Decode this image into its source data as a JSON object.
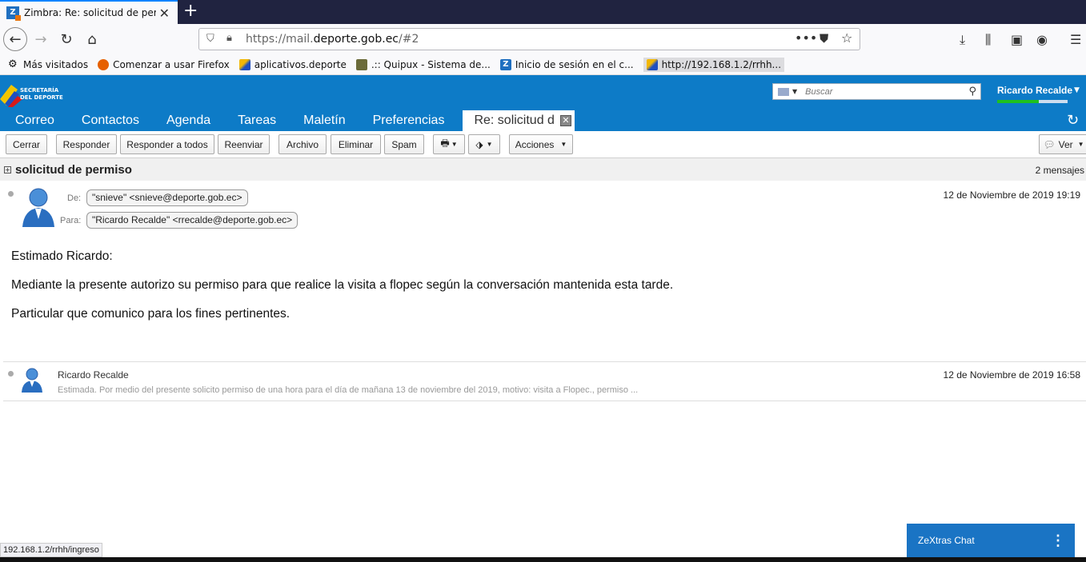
{
  "browser": {
    "tab_title": "Zimbra: Re: solicitud de permiso",
    "tab_favicon": "Z",
    "url_host_prefix": "https://mail.",
    "url_host": "deporte.gob.ec",
    "url_path": "/#2",
    "bookmarks": [
      {
        "label": "Más visitados",
        "icon": "gear-icon",
        "color": "#555555"
      },
      {
        "label": "Comenzar a usar Firefox",
        "icon": "firefox-icon",
        "color": "#e66000"
      },
      {
        "label": "aplicativos.deporte",
        "icon": "deporte-icon",
        "color": "#f2b705"
      },
      {
        "label": ".:: Quipux - Sistema de...",
        "icon": "quipux-icon",
        "color": "#6b6b3a"
      },
      {
        "label": "Inicio de sesión en el c...",
        "icon": "zimbra-icon",
        "color": "#1f6fc0"
      },
      {
        "label": "http://192.168.1.2/rrhh...",
        "icon": "deporte-icon",
        "color": "#f2b705"
      }
    ]
  },
  "zimbra": {
    "logo_line1": "SECRETARÍA",
    "logo_line2": "DEL DEPORTE",
    "search_placeholder": "Buscar",
    "user_name": "Ricardo Recalde",
    "app_tabs": [
      "Correo",
      "Contactos",
      "Agenda",
      "Tareas",
      "Maletín",
      "Preferencias"
    ],
    "active_tab": "Re: solicitud d",
    "toolbar": {
      "cerrar": "Cerrar",
      "responder": "Responder",
      "responder_todos": "Responder a todos",
      "reenviar": "Reenviar",
      "archivo": "Archivo",
      "eliminar": "Eliminar",
      "spam": "Spam",
      "acciones": "Acciones",
      "ver": "Ver"
    },
    "conversation": {
      "subject": "solicitud de permiso",
      "count": "2 mensajes"
    },
    "message1": {
      "from_label": "De:",
      "from": "\"snieve\" <snieve@deporte.gob.ec>",
      "to_label": "Para:",
      "to": "\"Ricardo Recalde\" <rrecalde@deporte.gob.ec>",
      "date": "12 de Noviembre de 2019 19:19",
      "body": [
        "Estimado Ricardo:",
        "Mediante la presente autorizo su permiso para que realice la visita a flopec según la conversación mantenida esta tarde.",
        "Particular que comunico para los fines pertinentes."
      ]
    },
    "message2": {
      "from": "Ricardo Recalde",
      "date": "12 de Noviembre de 2019 16:58",
      "snippet": "Estimada. Por medio del presente solicito permiso de una hora para el día de mañana 13 de noviembre del 2019, motivo: visita a Flopec., permiso ..."
    },
    "chat_label": "ZeXtras Chat"
  },
  "status_url": "192.168.1.2/rrhh/ingreso"
}
